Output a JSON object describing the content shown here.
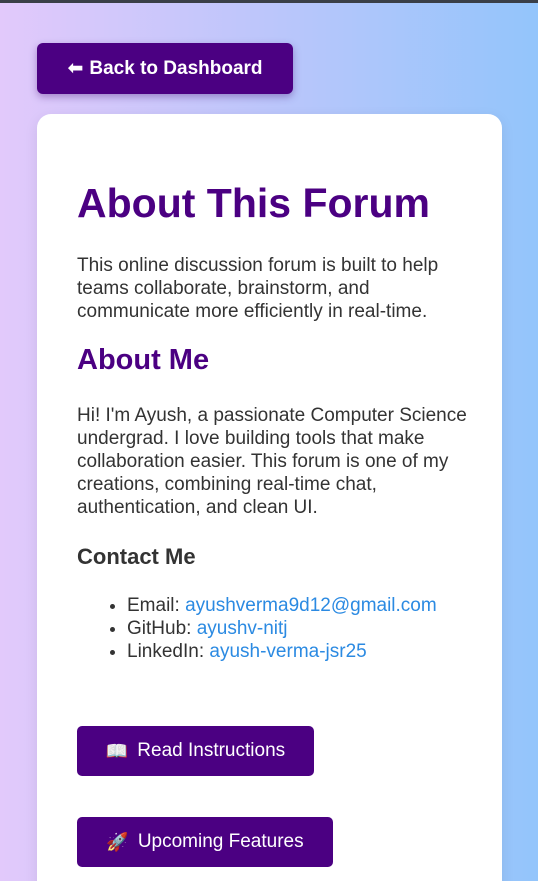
{
  "nav": {
    "back_arrow": "⬅",
    "back_label": "Back to Dashboard"
  },
  "about_forum": {
    "title": "About This Forum",
    "description": "This online discussion forum is built to help teams collaborate, brainstorm, and communicate more efficiently in real-time."
  },
  "about_me": {
    "title": "About Me",
    "bio": "Hi! I'm Ayush, a passionate Computer Science undergrad. I love building tools that make collaboration easier. This forum is one of my creations, combining real-time chat, authentication, and clean UI."
  },
  "contact": {
    "title": "Contact Me",
    "items": [
      {
        "label": "Email: ",
        "value": "ayushverma9d12@gmail.com"
      },
      {
        "label": "GitHub: ",
        "value": "ayushv-nitj"
      },
      {
        "label": "LinkedIn: ",
        "value": "ayush-verma-jsr25"
      }
    ]
  },
  "actions": {
    "instructions": {
      "icon": "📖",
      "label": "Read Instructions"
    },
    "features": {
      "icon": "🚀",
      "label": "Upcoming Features"
    }
  },
  "colors": {
    "accent": "#4b0082",
    "link": "#2b8ae2",
    "text": "#333333"
  }
}
